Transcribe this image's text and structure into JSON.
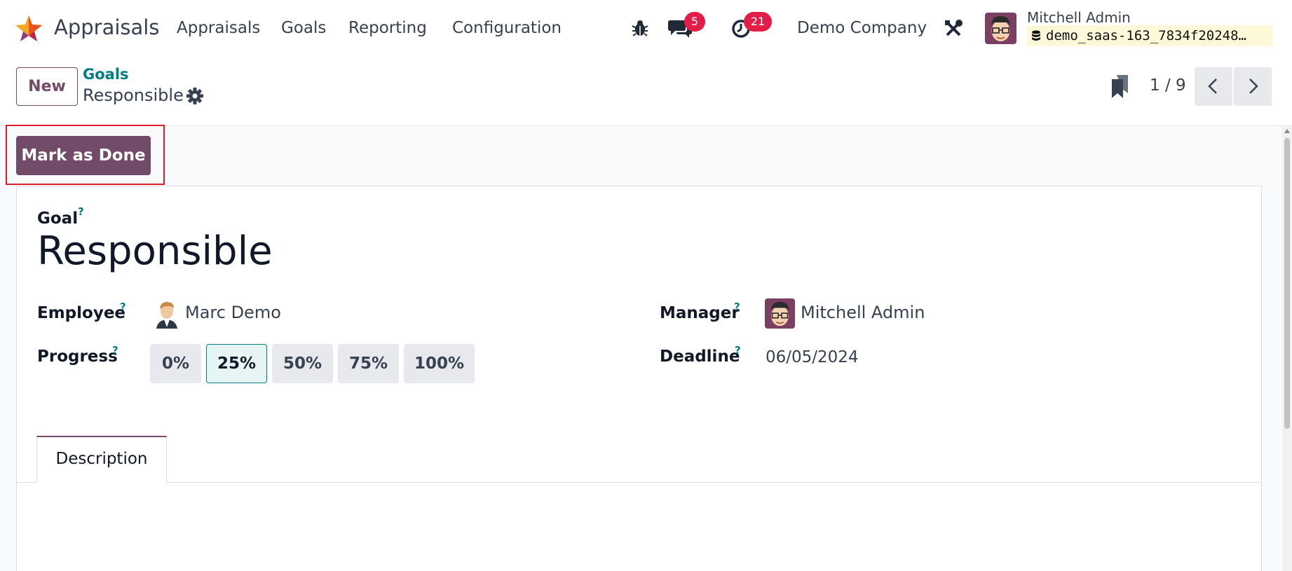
{
  "navbar": {
    "app_name": "Appraisals",
    "menu": [
      "Appraisals",
      "Goals",
      "Reporting",
      "Configuration"
    ],
    "messages_count": "5",
    "activities_count": "21",
    "company": "Demo Company",
    "user_name": "Mitchell Admin",
    "database": "demo_saas-163_7834f20248…"
  },
  "control": {
    "new_label": "New",
    "breadcrumb_parent": "Goals",
    "breadcrumb_current": "Responsible",
    "pager": "1 / 9"
  },
  "actions": {
    "mark_done_label": "Mark as Done"
  },
  "form": {
    "goal_label": "Goal",
    "goal_title": "Responsible",
    "employee_label": "Employee",
    "employee_value": "Marc Demo",
    "manager_label": "Manager",
    "manager_value": "Mitchell Admin",
    "progress_label": "Progress",
    "progress_options": [
      "0%",
      "25%",
      "50%",
      "75%",
      "100%"
    ],
    "progress_selected": "25%",
    "deadline_label": "Deadline",
    "deadline_value": "06/05/2024",
    "help_mark": "?",
    "tab_description": "Description"
  },
  "colors": {
    "brand": "#714b67",
    "accent": "#017e84",
    "badge": "#e11d48",
    "highlight": "#e11d2a"
  }
}
